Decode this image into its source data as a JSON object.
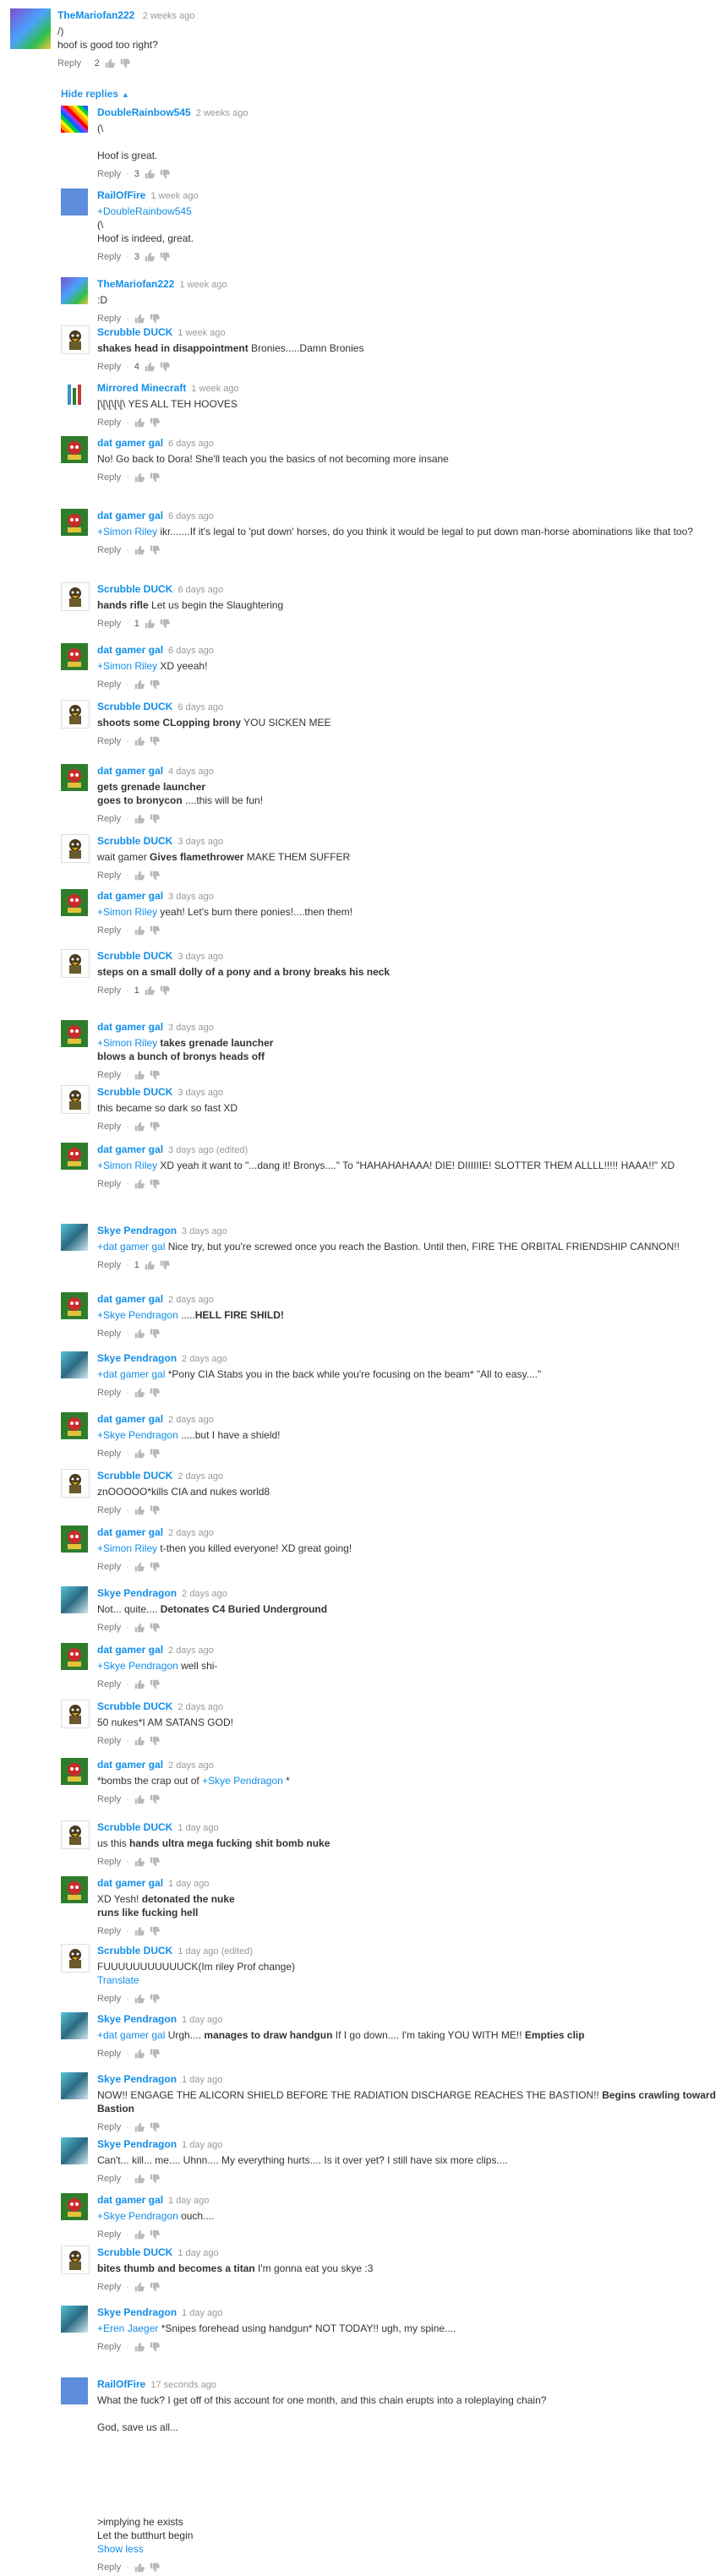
{
  "top_comment": {
    "author": "TheMariofan222",
    "time": "2 weeks ago",
    "text_lines": [
      "/)",
      "hoof is good too right?"
    ],
    "likes": "2",
    "reply_label": "Reply"
  },
  "hide_replies_label": "Hide replies",
  "replies": [
    {
      "author": "DoubleRainbow545",
      "time": "2 weeks ago",
      "text_html": "(\\<br><br>Hoof is great.",
      "likes": "3",
      "avatar": "rainbow"
    },
    {
      "author": "RailOfFire",
      "time": "1 week ago",
      "text_html": "<span class=\"mention\">+DoubleRainbow545</span><br>(\\<br>Hoof is indeed, great.",
      "likes": "3",
      "avatar": "rail"
    },
    {
      "author": "TheMariofan222",
      "time": "1 week ago",
      "text_html": ":D",
      "likes": "",
      "avatar": "mario"
    },
    {
      "author": "Scrubble DUCK",
      "time": "1 week ago",
      "text_html": "<b>shakes head in disappointment</b> Bronies.....Damn Bronies",
      "likes": "4",
      "avatar": "scrubble"
    },
    {
      "author": "Mirrored Minecraft",
      "time": "1 week ago",
      "text_html": "[\\[\\[\\[\\[\\ YES ALL TEH HOOVES",
      "likes": "",
      "avatar": "mirror"
    },
    {
      "author": "dat gamer gal",
      "time": "6 days ago",
      "text_html": "No! Go back to Dora! She'll teach you the basics of not becoming more insane",
      "likes": "",
      "avatar": "gamer"
    },
    {
      "author": "dat gamer gal",
      "time": "6 days ago",
      "text_html": "<span class=\"mention\">+Simon Riley</span> ikr.......If it's legal to 'put down' horses, do you think it would be legal to put down man-horse abominations like that too?",
      "likes": "",
      "avatar": "gamer"
    },
    {
      "author": "Scrubble DUCK",
      "time": "6 days ago",
      "text_html": "<b>hands rifle</b> Let us begin the Slaughtering",
      "likes": "1",
      "avatar": "scrubble"
    },
    {
      "author": "dat gamer gal",
      "time": "6 days ago",
      "text_html": "<span class=\"mention\">+Simon Riley</span> XD yeeah!",
      "likes": "",
      "avatar": "gamer"
    },
    {
      "author": "Scrubble DUCK",
      "time": "6 days ago",
      "text_html": "<b>shoots some CLopping brony</b> YOU SICKEN MEE",
      "likes": "",
      "avatar": "scrubble"
    },
    {
      "author": "dat gamer gal",
      "time": "4 days ago",
      "text_html": "<b>gets grenade launcher</b><br><b>goes to bronycon</b> ....this will be fun!",
      "likes": "",
      "avatar": "gamer"
    },
    {
      "author": "Scrubble DUCK",
      "time": "3 days ago",
      "text_html": "wait gamer <b>Gives flamethrower</b> MAKE THEM SUFFER",
      "likes": "",
      "avatar": "scrubble"
    },
    {
      "author": "dat gamer gal",
      "time": "3 days ago",
      "text_html": "<span class=\"mention\">+Simon Riley</span> yeah! Let's burn there ponies!....then them!",
      "likes": "",
      "avatar": "gamer"
    },
    {
      "author": "Scrubble DUCK",
      "time": "3 days ago",
      "text_html": "<b>steps on a small dolly of a pony and a brony breaks his neck</b>",
      "likes": "1",
      "avatar": "scrubble"
    },
    {
      "author": "dat gamer gal",
      "time": "3 days ago",
      "text_html": "<span class=\"mention\">+Simon Riley</span> <b>takes grenade launcher</b><br><b>blows a bunch of bronys heads off</b>",
      "likes": "",
      "avatar": "gamer"
    },
    {
      "author": "Scrubble DUCK",
      "time": "3 days ago",
      "text_html": "this became so dark so fast XD",
      "likes": "",
      "avatar": "scrubble"
    },
    {
      "author": "dat gamer gal",
      "time": "3 days ago (edited)",
      "text_html": "<span class=\"mention\">+Simon Riley</span> XD yeah it want to \"...dang it! Bronys....\" To \"HAHAHAHAAA! DIE! DIIIIIIE! SLOTTER THEM ALLLL!!!!! HAAA!!\" XD",
      "likes": "",
      "avatar": "gamer"
    },
    {
      "author": "Skye Pendragon",
      "time": "3 days ago",
      "text_html": "<span class=\"mention\">+dat gamer gal</span> Nice try, but you're screwed once you reach the Bastion. Until then, FIRE THE ORBITAL FRIENDSHIP CANNON!!",
      "likes": "1",
      "avatar": "skye"
    },
    {
      "author": "dat gamer gal",
      "time": "2 days ago",
      "text_html": "<span class=\"mention\">+Skye Pendragon</span> .....<b>HELL FIRE SHILD!</b>",
      "likes": "",
      "avatar": "gamer"
    },
    {
      "author": "Skye Pendragon",
      "time": "2 days ago",
      "text_html": "<span class=\"mention\">+dat gamer gal</span> *Pony CIA Stabs you in the back while you're focusing on the beam* \"All to easy....\"",
      "likes": "",
      "avatar": "skye"
    },
    {
      "author": "dat gamer gal",
      "time": "2 days ago",
      "text_html": "<span class=\"mention\">+Skye Pendragon</span> .....but I have a shield!",
      "likes": "",
      "avatar": "gamer"
    },
    {
      "author": "Scrubble DUCK",
      "time": "2 days ago",
      "text_html": "znOOOOO*kills CIA and nukes world8",
      "likes": "",
      "avatar": "scrubble"
    },
    {
      "author": "dat gamer gal",
      "time": "2 days ago",
      "text_html": "<span class=\"mention\">+Simon Riley</span> t-then you killed everyone! XD great going!",
      "likes": "",
      "avatar": "gamer"
    },
    {
      "author": "Skye Pendragon",
      "time": "2 days ago",
      "text_html": "Not... quite.... <b>Detonates C4 Buried Underground</b>",
      "likes": "",
      "avatar": "skye"
    },
    {
      "author": "dat gamer gal",
      "time": "2 days ago",
      "text_html": "<span class=\"mention\">+Skye Pendragon</span> well shi-",
      "likes": "",
      "avatar": "gamer"
    },
    {
      "author": "Scrubble DUCK",
      "time": "2 days ago",
      "text_html": "50 nukes*I AM SATANS GOD!",
      "likes": "",
      "avatar": "scrubble"
    },
    {
      "author": "dat gamer gal",
      "time": "2 days ago",
      "text_html": "*bombs the crap out of <span class=\"mention\">+Skye Pendragon</span> *",
      "likes": "",
      "avatar": "gamer"
    },
    {
      "author": "Scrubble DUCK",
      "time": "1 day ago",
      "text_html": "us this <b>hands ultra mega fucking shit bomb nuke</b>",
      "likes": "",
      "avatar": "scrubble"
    },
    {
      "author": "dat gamer gal",
      "time": "1 day ago",
      "text_html": "XD Yesh! <b>detonated the nuke</b><br><b>runs like fucking hell</b>",
      "likes": "",
      "avatar": "gamer"
    },
    {
      "author": "Scrubble DUCK",
      "time": "1 day ago (edited)",
      "text_html": "FUUUUUUUUUUUCK(Im riley Prof change)<br><span class=\"mention\">Translate</span>",
      "likes": "",
      "avatar": "scrubble"
    },
    {
      "author": "Skye Pendragon",
      "time": "1 day ago",
      "text_html": "<span class=\"mention\">+dat gamer gal</span> Urgh.... <b>manages to draw handgun</b> If I go down.... I'm taking YOU WITH ME!! <b>Empties clip</b>",
      "likes": "",
      "avatar": "skye"
    },
    {
      "author": "Skye Pendragon",
      "time": "1 day ago",
      "text_html": "NOW!! ENGAGE THE ALICORN SHIELD BEFORE THE RADIATION DISCHARGE REACHES THE BASTION!! <b>Begins crawling toward Bastion</b>",
      "likes": "",
      "avatar": "skye"
    },
    {
      "author": "Skye Pendragon",
      "time": "1 day ago",
      "text_html": "Can't... kill... me.... Uhnn.... My everything hurts.... Is it over yet? I still have six more clips....",
      "likes": "",
      "avatar": "skye"
    },
    {
      "author": "dat gamer gal",
      "time": "1 day ago",
      "text_html": "<span class=\"mention\">+Skye Pendragon</span> ouch....",
      "likes": "",
      "avatar": "gamer"
    },
    {
      "author": "Scrubble DUCK",
      "time": "1 day ago",
      "text_html": "<b>bites thumb and becomes a titan</b> I'm gonna eat you skye :3",
      "likes": "",
      "avatar": "scrubble"
    },
    {
      "author": "Skye Pendragon",
      "time": "1 day ago",
      "text_html": "<span class=\"mention\">+Eren Jaeger</span> *Snipes forehead using handgun* NOT TODAY!! ugh, my spine....",
      "likes": "",
      "avatar": "skye"
    },
    {
      "author": "RailOfFire",
      "time": "17 seconds ago",
      "text_html": "What the fuck? I get off of this account for one month, and this chain erupts into a roleplaying chain?<br><br>God, save us all...<br><br><br><br><br><br><br>&gt;implying he exists<br>Let the butthurt begin<br><span class=\"mention\">Show less</span>",
      "likes": "",
      "avatar": "rail"
    }
  ]
}
